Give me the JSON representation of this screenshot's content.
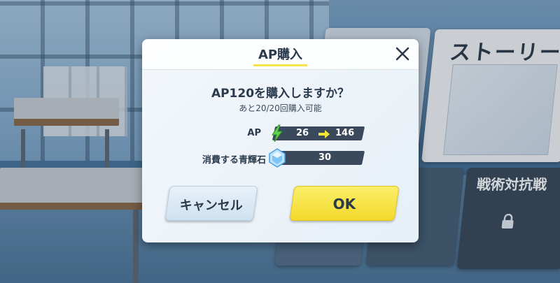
{
  "background": {
    "story_card_title": "ストーリー",
    "tactical_card_title": "戦術対抗戦"
  },
  "dialog": {
    "title": "AP購入",
    "question": "AP120を購入しますか？",
    "remaining": "あと20/20回購入可能",
    "ap_row": {
      "label": "AP",
      "icon": "lightning-bolt-icon",
      "current": "26",
      "after": "146"
    },
    "cost_row": {
      "label": "消費する青輝石",
      "icon": "blue-gem-icon",
      "value": "30"
    },
    "cancel_label": "キャンセル",
    "ok_label": "OK"
  },
  "colors": {
    "ok_yellow": "#f3d92b",
    "cancel_blue": "#cfe1ef",
    "bar_dark": "#3a4a5c",
    "bolt_green": "#5fd14a",
    "arrow_yellow": "#f2e43a"
  }
}
